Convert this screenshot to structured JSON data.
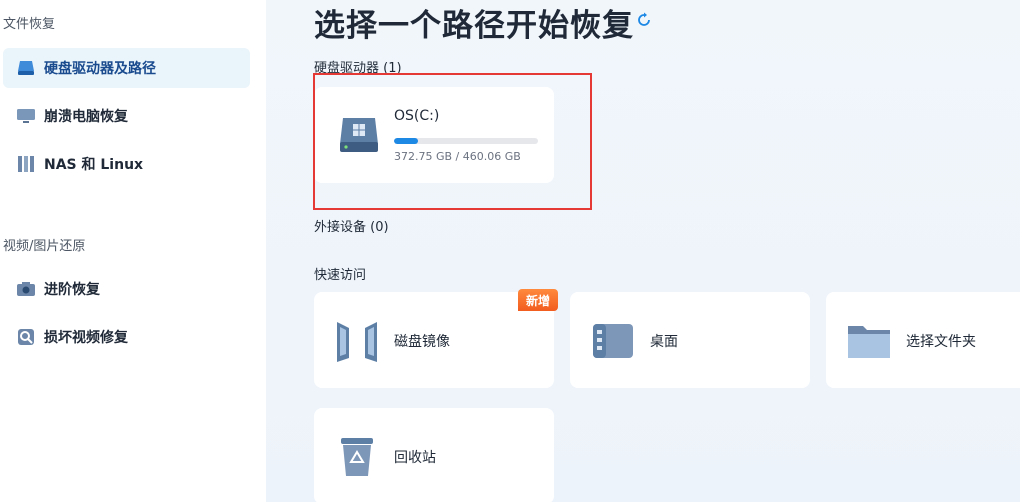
{
  "sidebar": {
    "section_file": "文件恢复",
    "section_media": "视频/图片还原",
    "items": [
      {
        "label": "硬盘驱动器及路径",
        "icon": "drive-icon"
      },
      {
        "label": "崩溃电脑恢复",
        "icon": "monitor-icon"
      },
      {
        "label": "NAS 和 Linux",
        "icon": "nas-icon"
      },
      {
        "label": "进阶恢复",
        "icon": "camera-icon"
      },
      {
        "label": "损坏视频修复",
        "icon": "video-repair-icon"
      }
    ]
  },
  "main": {
    "title": "选择一个路径开始恢复",
    "hard_drives_label": "硬盘驱动器 (1)",
    "external_label": "外接设备 (0)",
    "quick_access_label": "快速访问",
    "drive": {
      "name": "OS(C:)",
      "size_text": "372.75 GB / 460.06 GB",
      "usage_fraction": 0.17
    },
    "quick_access": [
      {
        "label": "磁盘镜像",
        "icon": "disk-image-icon",
        "badge": "新增"
      },
      {
        "label": "桌面",
        "icon": "desktop-icon"
      },
      {
        "label": "选择文件夹",
        "icon": "folder-icon"
      },
      {
        "label": "回收站",
        "icon": "recycle-bin-icon"
      }
    ]
  },
  "colors": {
    "accent": "#1e88e5",
    "highlight_border": "#e53935",
    "badge": "#f25c1f"
  }
}
